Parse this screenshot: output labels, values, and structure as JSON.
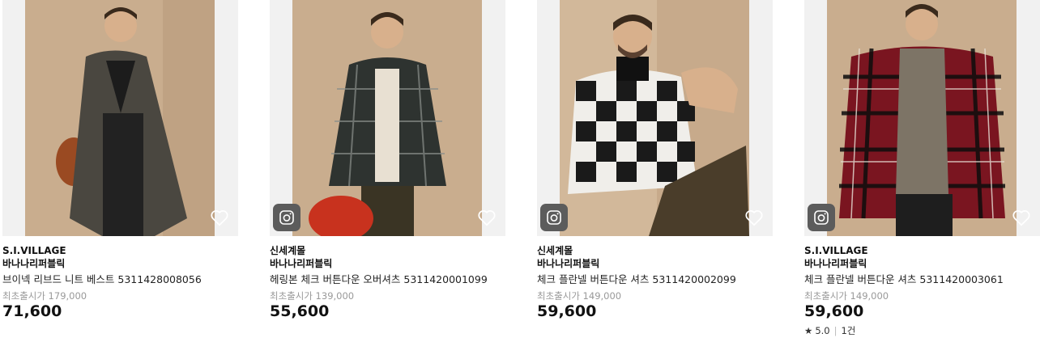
{
  "products": [
    {
      "seller": "S.I.VILLAGE",
      "brand": "바나나리퍼블릭",
      "name": "브이넥 리브드 니트 베스트 5311428008056",
      "original_price": "최초출시가 179,000",
      "price": "71,600",
      "has_instagram": false,
      "image_icon": "photo-man-overcoat"
    },
    {
      "seller": "신세계몰",
      "brand": "바나나리퍼블릭",
      "name": "헤링본 체크 버튼다운 오버셔츠 5311420001099",
      "original_price": "최초출시가 139,000",
      "price": "55,600",
      "has_instagram": true,
      "image_icon": "photo-man-plaid-overshirt"
    },
    {
      "seller": "신세계몰",
      "brand": "바나나리퍼블릭",
      "name": "체크 플란넬 버튼다운 셔츠 5311420002099",
      "original_price": "최초출시가 149,000",
      "price": "59,600",
      "has_instagram": true,
      "image_icon": "photo-man-buffalo-check"
    },
    {
      "seller": "S.I.VILLAGE",
      "brand": "바나나리퍼블릭",
      "name": "체크 플란넬 버튼다운 셔츠 5311420003061",
      "original_price": "최초출시가 149,000",
      "price": "59,600",
      "has_instagram": true,
      "image_icon": "photo-man-red-flannel",
      "rating": {
        "star": "★",
        "score": "5.0",
        "count": "1건"
      }
    }
  ],
  "colors": {
    "photo_bg": "#c9ad8e",
    "badge_bg": "#5c5c5c",
    "muted_text": "#999999"
  }
}
